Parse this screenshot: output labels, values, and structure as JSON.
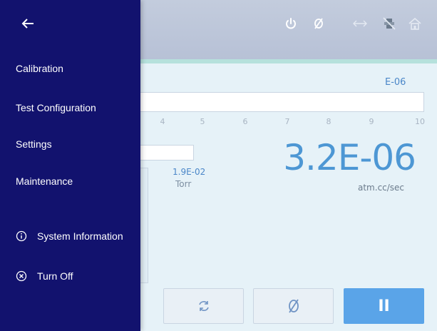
{
  "drawer": {
    "back_icon": "arrow-left-icon",
    "items": [
      {
        "label": "Calibration"
      },
      {
        "label": "Test Configuration"
      },
      {
        "label": "Settings"
      },
      {
        "label": "Maintenance"
      }
    ],
    "system_information": {
      "label": "System Information",
      "icon": "info-circle-icon"
    },
    "turn_off": {
      "label": "Turn Off",
      "icon": "close-circle-icon"
    }
  },
  "toolbar": {
    "icons": [
      "power-icon",
      "zero-icon",
      "swap-arrows-icon",
      "valve-icon",
      "home-icon"
    ]
  },
  "scale": {
    "unit": "E-06",
    "ticks": [
      "4",
      "5",
      "6",
      "7",
      "8",
      "9",
      "10"
    ]
  },
  "pressure": {
    "value": "1.9E-02",
    "unit": "Torr"
  },
  "leak_rate": {
    "value": "3.2E-06",
    "unit": "atm.cc/sec"
  },
  "buttons": {
    "refresh_icon": "refresh-icon",
    "zero_icon": "zero-icon",
    "pause_label": "II"
  },
  "colors": {
    "drawer_bg": "#12126e",
    "accent_blue": "#5aa4e8",
    "value_blue": "#4d97d4",
    "topbar": "#bcc6da",
    "teal_strip": "#b6e1dc"
  }
}
